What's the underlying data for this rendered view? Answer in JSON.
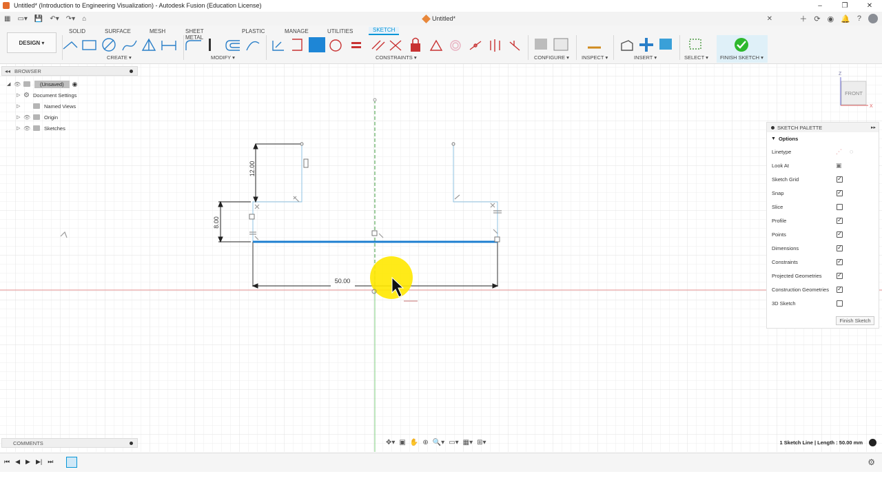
{
  "window": {
    "title": "Untitled* (Introduction to Engineering Visualization) - Autodesk Fusion (Education License)",
    "controls": [
      "–",
      "❐",
      "✕"
    ]
  },
  "document_tab": {
    "label": "Untitled*"
  },
  "ribbon": {
    "workspace": "DESIGN ▾",
    "tabs": [
      "SOLID",
      "SURFACE",
      "MESH",
      "SHEET METAL",
      "PLASTIC",
      "MANAGE",
      "UTILITIES",
      "SKETCH"
    ],
    "active_tab": "SKETCH",
    "groups": {
      "create": "CREATE ▾",
      "modify": "MODIFY ▾",
      "constraints": "CONSTRAINTS ▾",
      "configure": "CONFIGURE ▾",
      "inspect": "INSPECT ▾",
      "insert": "INSERT ▾",
      "select": "SELECT ▾",
      "finish_sketch": "FINISH SKETCH ▾"
    }
  },
  "browser": {
    "title": "BROWSER",
    "items": [
      {
        "label": "(Unsaved)"
      },
      {
        "label": "Document Settings"
      },
      {
        "label": "Named Views"
      },
      {
        "label": "Origin"
      },
      {
        "label": "Sketches"
      }
    ]
  },
  "viewcube": {
    "face": "FRONT",
    "axis_z": "Z",
    "axis_x": "X"
  },
  "sketch": {
    "dimensions": {
      "width": "50.00",
      "height_upper": "12.00",
      "height_lower": "8.00"
    }
  },
  "palette": {
    "title": "SKETCH PALETTE",
    "section": "Options",
    "rows": [
      {
        "label": "Linetype",
        "type": "icon"
      },
      {
        "label": "Look At",
        "type": "icon"
      },
      {
        "label": "Sketch Grid",
        "checked": true
      },
      {
        "label": "Snap",
        "checked": true
      },
      {
        "label": "Slice",
        "checked": false
      },
      {
        "label": "Profile",
        "checked": true
      },
      {
        "label": "Points",
        "checked": true
      },
      {
        "label": "Dimensions",
        "checked": true
      },
      {
        "label": "Constraints",
        "checked": true
      },
      {
        "label": "Projected Geometries",
        "checked": true
      },
      {
        "label": "Construction Geometries",
        "checked": true
      },
      {
        "label": "3D Sketch",
        "checked": false
      }
    ],
    "finish_button": "Finish Sketch"
  },
  "comments": {
    "title": "COMMENTS"
  },
  "status": {
    "text": "1 Sketch Line | Length : 50.00 mm"
  },
  "colors": {
    "accent": "#0696d7",
    "sketch_line": "#1e7fd0",
    "cursor_highlight": "#ffe800"
  }
}
